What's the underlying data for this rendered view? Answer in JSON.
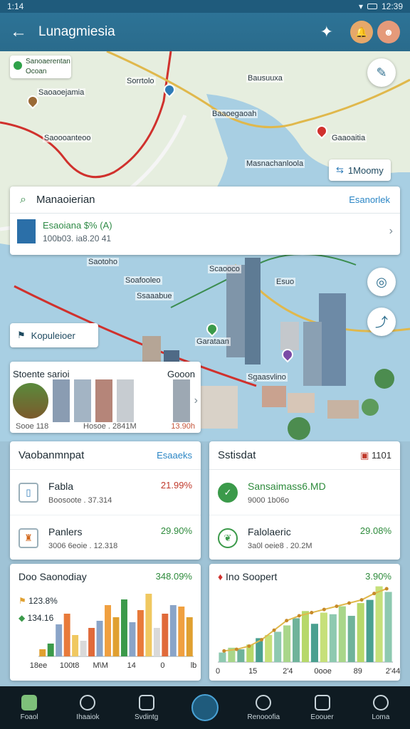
{
  "status": {
    "time": "1:14",
    "right": "12:39"
  },
  "appbar": {
    "title": "Lunagmiesia",
    "back_icon": "arrow-left-icon",
    "pin_icon": "pin-icon"
  },
  "map": {
    "location_chip": {
      "line1": "Sanoaerentan",
      "line2": "Ocoan"
    },
    "labels": [
      "Saoaoejamia",
      "Sorrtolo",
      "Baaoegaoah",
      "Saoooanteoo",
      "Masnachanloola",
      "Gaaoaitia",
      "Bausuuxa",
      "Saotoho",
      "Soafooleo",
      "Ssaaabue",
      "Scaooco",
      "Garataan",
      "Esuo",
      "Sgaasvlino"
    ],
    "mode_chip": "1Moomy",
    "label_chip": "Kopuleioer"
  },
  "search": {
    "query": "Manaoierian",
    "link": "Esanorlek",
    "result_title": "Esaoiana $% (A)",
    "result_sub": "100b03. ia8.20 41"
  },
  "place_card": {
    "title": "Stoente sarioi",
    "right_title": "Gooon",
    "foot_left": "Sooe 118",
    "foot_mid": "Hosoe . 2841M",
    "foot_right": "13.90h"
  },
  "card_left": {
    "title": "Vaobanmnpat",
    "link": "Esaaeks",
    "rows": [
      {
        "label": "Fabla",
        "sub": "Boosoote . 37.314",
        "value": "21.99%",
        "color": "#c0392b"
      },
      {
        "label": "Panlers",
        "sub": "3006 6eoie . 12.318",
        "value": "29.90%",
        "color": "#2e8b3c"
      }
    ]
  },
  "card_right": {
    "title": "Sstisdat",
    "badge": "1101",
    "rows": [
      {
        "label": "Sansaimass6.MD",
        "sub": "9000 1b06o",
        "value": "",
        "color": "#2e8b3c"
      },
      {
        "label": "Falolaeric",
        "sub": "3a0l oeie8 . 20.2M",
        "value": "29.08%",
        "color": "#2e8b3c"
      }
    ]
  },
  "chart_left": {
    "title": "Doo Saonodiay",
    "value": "348.09%",
    "legend": [
      {
        "label": "123.8%"
      },
      {
        "label": "134.16"
      }
    ],
    "x_labels": [
      "18ee",
      "100t8",
      "M\\M",
      "14",
      "0",
      "lb"
    ]
  },
  "chart_right": {
    "title": "Ino Soopert",
    "value": "3.90%",
    "x_labels": [
      "0",
      "15",
      "2'4",
      "0ooe",
      "89",
      "2'44"
    ]
  },
  "chart_data": [
    {
      "type": "bar",
      "title": "Doo Saonodiay",
      "categories": [
        "18ee",
        "100t8",
        "M\\M",
        "14",
        "0",
        "lb"
      ],
      "series": [
        {
          "values": [
            10,
            18,
            45,
            60,
            30,
            22,
            40,
            50,
            72,
            55,
            80,
            48,
            65,
            88,
            40,
            60,
            72,
            70,
            55
          ]
        }
      ],
      "ylim": [
        0,
        100
      ]
    },
    {
      "type": "bar",
      "title": "Ino Soopert",
      "categories": [
        "0",
        "15",
        "2'4",
        "0ooe",
        "89",
        "2'44"
      ],
      "series": [
        {
          "values": [
            12,
            18,
            16,
            22,
            30,
            34,
            38,
            46,
            55,
            64,
            48,
            62,
            60,
            70,
            58,
            74,
            78,
            95,
            88
          ]
        },
        {
          "values": [
            14,
            16,
            20,
            28,
            40,
            52,
            58,
            62,
            66,
            70,
            74,
            78,
            86,
            92
          ]
        }
      ],
      "ylim": [
        0,
        100
      ]
    }
  ],
  "nav": {
    "items": [
      {
        "label": "Foaol",
        "icon": "home-icon"
      },
      {
        "label": "Ihaaiok",
        "icon": "search-icon"
      },
      {
        "label": "Svdintg",
        "icon": "clock-icon"
      },
      {
        "label": "",
        "icon": "compass-icon"
      },
      {
        "label": "Renooofia",
        "icon": "settings-icon"
      },
      {
        "label": "Eoouer",
        "icon": "camera-icon"
      },
      {
        "label": "Loma",
        "icon": "person-icon"
      }
    ]
  }
}
